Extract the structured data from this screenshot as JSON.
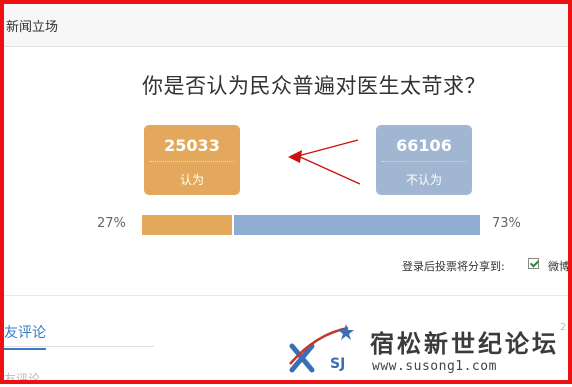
{
  "header": {
    "title": "新闻立场"
  },
  "poll": {
    "question": "你是否认为民众普遍对医生太苛求？",
    "yes": {
      "count": "25033",
      "label": "认为",
      "percent_text": "27%",
      "fraction": 0.27
    },
    "no": {
      "count": "66106",
      "label": "不认为",
      "percent_text": "73%",
      "fraction": 0.73
    }
  },
  "share": {
    "text": "登录后投票将分享到:",
    "checkbox_label": "微博",
    "checked": true
  },
  "comments": {
    "tab_label": "友评论",
    "faded_text": "友评论"
  },
  "watermark": {
    "title": "宿松新世纪论坛",
    "url": "www.susong1.com",
    "logo_letters": "SJ",
    "trailing_mark": "2"
  },
  "colors": {
    "yes": "#e3a85b",
    "no": "#a1b6d1",
    "bar_no": "#8fadd1",
    "frame": "#ee1111",
    "arrow": "#cc1111",
    "accent_link": "#3a7bc8"
  }
}
